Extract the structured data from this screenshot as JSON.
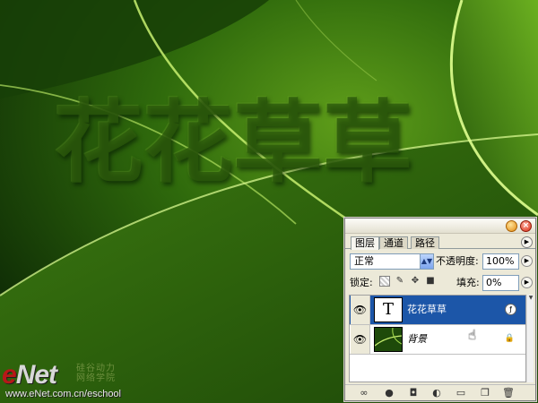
{
  "canvas": {
    "title_text": "花花草草",
    "background_color": "#1f4a0c",
    "accent_color": "#c8f070"
  },
  "watermark": {
    "brand_e": "e",
    "brand_rest": "Net",
    "sub_line1": "硅谷动力",
    "sub_line2": "网络学院",
    "url": "www.eNet.com.cn/eschool"
  },
  "layers_panel": {
    "tabs": [
      {
        "label": "图层",
        "active": true
      },
      {
        "label": "通道",
        "active": false
      },
      {
        "label": "路径",
        "active": false
      }
    ],
    "blend_mode": "正常",
    "opacity_label": "不透明度:",
    "opacity_value": "100%",
    "lock_label": "锁定:",
    "fill_label": "填充:",
    "fill_value": "0%",
    "layers": [
      {
        "name": "花花草草",
        "thumb": "T",
        "selected": true,
        "visible": true
      },
      {
        "name": "背景",
        "selected": false,
        "visible": true,
        "locked": true
      }
    ]
  },
  "icons": {
    "eye": "eye-icon",
    "fx": "layer-style-icon",
    "lock": "lock-icon",
    "link": "link-layers-icon",
    "add_style": "add-layer-style-icon",
    "mask": "add-mask-icon",
    "adjust": "new-adjustment-layer-icon",
    "folder": "new-group-icon",
    "new_layer": "new-layer-icon",
    "trash": "delete-layer-icon"
  }
}
